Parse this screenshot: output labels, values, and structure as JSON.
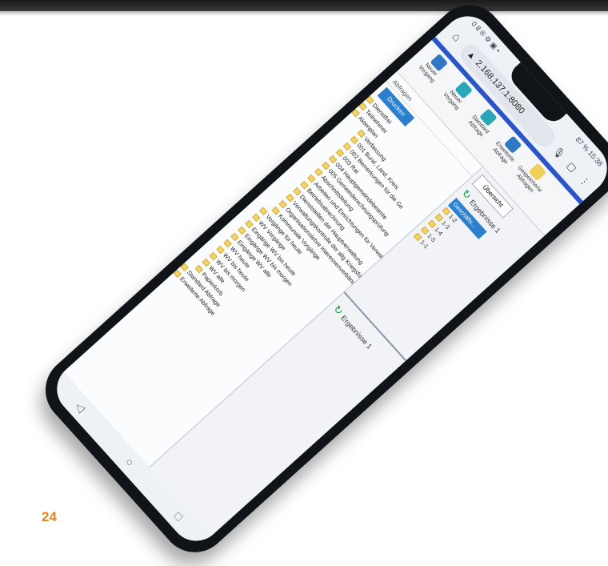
{
  "page_number": "24",
  "phone": {
    "status": {
      "left": "0 8 ® ⚙ ▣ •",
      "right": "87 % 15:38"
    },
    "browser": {
      "url": "2.168.137.1:8080"
    },
    "toolbar": [
      {
        "label": "Neuer Vorgang",
        "icon": "blue"
      },
      {
        "label": "Neuer Vorgang",
        "icon": "teal"
      },
      {
        "label": "Standard Abfrage",
        "icon": "teal"
      },
      {
        "label": "Erweiterte Abfrage",
        "icon": "blue"
      },
      {
        "label": "Gespeicherte Abfragen",
        "icon": "yellow"
      }
    ],
    "tree": {
      "header": "Abfragen",
      "print": "Drucken",
      "items": [
        {
          "label": "Dienstfrei"
        },
        {
          "label": "Teilnehmer"
        },
        {
          "label": "Aktenplan"
        },
        {
          "label": "Verfassung",
          "level": 2
        },
        {
          "label": "001 Bund, Land, Kreis",
          "level": 2
        },
        {
          "label": "002 Bemerkungen für die Ge",
          "level": 2
        },
        {
          "label": "003 Rat",
          "level": 2
        },
        {
          "label": "004 Hauptgemeindebeamte",
          "level": 2
        },
        {
          "label": "005 Gemeinderechnungsprüfung",
          "level": 2
        },
        {
          "label": "Abschnittsleitung",
          "level": 2
        },
        {
          "label": "Arbeiten und Einrichtungen für Verwaltung",
          "level": 2
        },
        {
          "label": "Betriebsabrechnung",
          "level": 2
        },
        {
          "label": "Dienststellen der Hauptverwaltung",
          "level": 2
        },
        {
          "label": "Verwaltungskontrolle der allg Kriegsführung",
          "level": 2
        },
        {
          "label": "Organisationslehre Interessenverbände",
          "level": 2
        },
        {
          "label": "Kommunale Vorgänge",
          "level": 2
        },
        {
          "label": "Vorgänge für heute",
          "level": 1
        },
        {
          "label": "WV Vorgänge",
          "level": 1
        },
        {
          "label": "Eingänge WV bis heute",
          "level": 1
        },
        {
          "label": "Eingänge WV bis morgen",
          "level": 1
        },
        {
          "label": "Eingänge WV alle",
          "level": 1
        },
        {
          "label": "WV heute",
          "level": 1
        },
        {
          "label": "WV bis heute",
          "level": 1
        },
        {
          "label": "WV bis morgen",
          "level": 1
        },
        {
          "label": "WV alle",
          "level": 1
        },
        {
          "label": "Papierkorb",
          "level": 1
        },
        {
          "label": "Standard Abfrage",
          "level": 0
        },
        {
          "label": "Erweiterte Abfrage",
          "level": 0
        }
      ]
    },
    "results": {
      "tab": "Übersicht",
      "top_title": "Ergebnisse 1",
      "folder_button": "Geschäfts...",
      "folders": [
        "1-2",
        "1-3",
        "1-4",
        "1-5",
        "1-1"
      ],
      "bottom_title": "Ergebnisse 1"
    },
    "nav": {
      "back": "◁",
      "home": "○",
      "recent": "□"
    }
  }
}
